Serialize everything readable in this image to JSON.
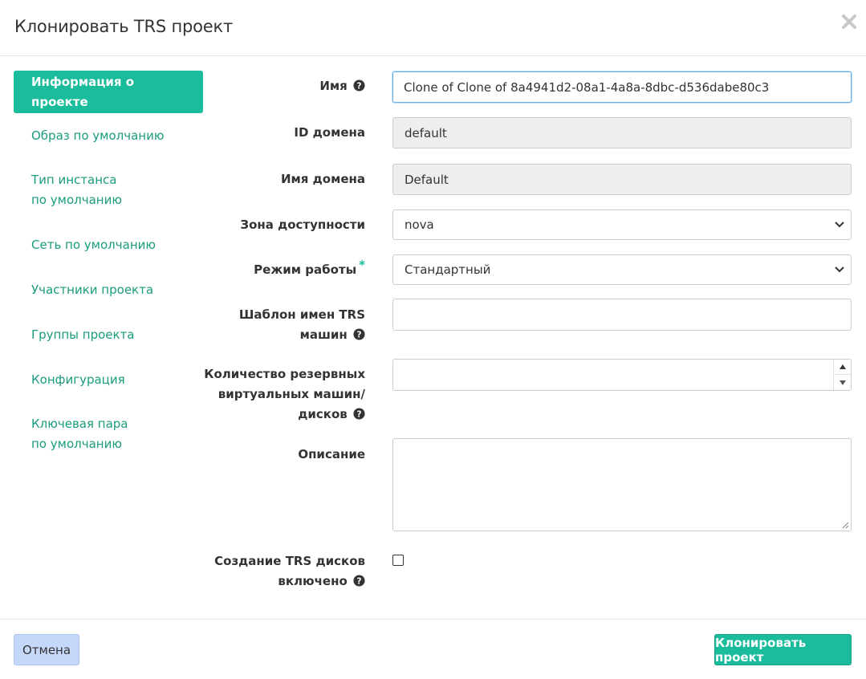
{
  "modal": {
    "title": "Клонировать TRS проект",
    "close_icon": "close-icon"
  },
  "nav": {
    "items": [
      {
        "label": "Информация о проекте",
        "active": true
      },
      {
        "label": "Образ по умолчанию"
      },
      {
        "label": "Тип инстанса по умолчанию"
      },
      {
        "label": "Сеть по умолчанию"
      },
      {
        "label": "Участники проекта"
      },
      {
        "label": "Группы проекта"
      },
      {
        "label": "Конфигурация"
      },
      {
        "label": "Ключевая пара по умолчанию"
      }
    ]
  },
  "form": {
    "name": {
      "label": "Имя",
      "value": "Clone of Clone of 8a4941d2-08a1-4a8a-8dbc-d536dabe80c3"
    },
    "domain_id": {
      "label": "ID домена",
      "value": "default"
    },
    "domain_name": {
      "label": "Имя домена",
      "value": "Default"
    },
    "availability_zone": {
      "label": "Зона доступности",
      "value": "nova"
    },
    "mode": {
      "label": "Режим работы",
      "required_mark": "*",
      "value": "Стандартный"
    },
    "name_template": {
      "label_line1": "Шаблон имен TRS",
      "label_line2": "машин",
      "value": ""
    },
    "reserve_count": {
      "label_line1": "Количество резервных",
      "label_line2": "виртуальных машин/",
      "label_line3": "дисков",
      "value": ""
    },
    "description": {
      "label": "Описание",
      "value": ""
    },
    "trs_disks": {
      "label_line1": "Создание TRS дисков",
      "label_line2": "включено",
      "checked": false
    }
  },
  "footer": {
    "cancel_label": "Отмена",
    "submit_label": "Клонировать проект"
  },
  "colors": {
    "accent": "#1abc9c",
    "link": "#1a9c7e",
    "cancel_bg": "#c6d8fa"
  }
}
